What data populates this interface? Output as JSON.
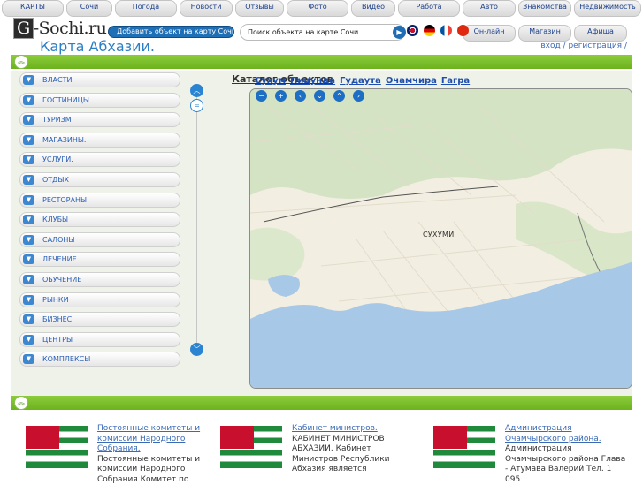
{
  "nav": {
    "row1": [
      "КАРТЫ",
      "Сочи",
      "Погода",
      "Новости",
      "Отзывы",
      "Фото",
      "Видео",
      "Работа",
      "Авто",
      "Знакомства",
      "Недвижимость"
    ],
    "row2": [
      "Он-лайн",
      "Магазин",
      "Афиша"
    ]
  },
  "logo": {
    "text": "-Sochi.ru",
    "letter": "G"
  },
  "add_object_label": "Добавить объект на карту Сочи",
  "search": {
    "placeholder": "Поиск объекта на карте Сочи",
    "value": "Поиск объекта на карте Сочи"
  },
  "page_title": "Карта Абхазии.",
  "auth": {
    "login": "вход",
    "register": "регистрация"
  },
  "categories": [
    "ВЛАСТИ.",
    "ГОСТИНИЦЫ",
    "ТУРИЗМ",
    "МАГАЗИНЫ.",
    "УСЛУГИ.",
    "ОТДЫХ",
    "РЕСТОРАНЫ",
    "КЛУБЫ",
    "САЛОНЫ",
    "ЛЕЧЕНИЕ",
    "ОБУЧЕНИЕ",
    "РЫНКИ",
    "БИЗНЕС",
    "ЦЕНТРЫ",
    "КОМПЛЕКСЫ"
  ],
  "catalog_label": "Каталог объектов",
  "cities": [
    "Сухум",
    "Пицунда",
    "Гудаута",
    "Очамчира",
    "Гагра"
  ],
  "map": {
    "city_label": "СУХУМИ",
    "sea_color": "#a7c8e6",
    "land_color": "#f2eee2",
    "forest_color": "#d4e3c3"
  },
  "news": [
    {
      "title": "Постоянные комитеты и комиссии Народного Собрания.",
      "body": "Постоянные комитеты и комиссии Народного Собрания Комитет по"
    },
    {
      "title": "Кабинет министров.",
      "body": "КАБИНЕТ МИНИСТРОВ АБХАЗИИ. Кабинет Министров Республики Абхазия является"
    },
    {
      "title": "Администрация Очамчырского района.",
      "body": "Администрация Очамчырского района Глава - Атумава Валерий Тел. 1 095"
    }
  ],
  "colors": {
    "accent_green": "#7bc02a",
    "link_blue": "#1e4fb0",
    "button_blue": "#1e6fb5"
  }
}
